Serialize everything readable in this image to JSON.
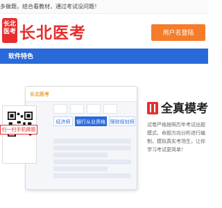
{
  "topbar": {
    "tip": "多做题，结合看教材，通过考试没问题！"
  },
  "header": {
    "seal_chars": [
      "长北",
      "医考"
    ],
    "logo_text": "长北医考",
    "login_button": "用户名登陆"
  },
  "band": {
    "label": "软件特色"
  },
  "monitor": {
    "mini_logo": "长北医考",
    "tabs": [
      "经济师",
      "银行从业资格",
      "理财规划师"
    ],
    "active_tab_index": 1
  },
  "qr": {
    "caption": "扫一扫手机做题"
  },
  "feature": {
    "title": "全真模考",
    "description": "试卷严格按照历年考试出题模式、命题方向分析进行编制，模拟真实考场生，让你学习考试更简单！"
  },
  "colors": {
    "brand_red": "#e62e2e",
    "band_blue": "#2a6ad8",
    "login_orange": "#f57c2b"
  }
}
